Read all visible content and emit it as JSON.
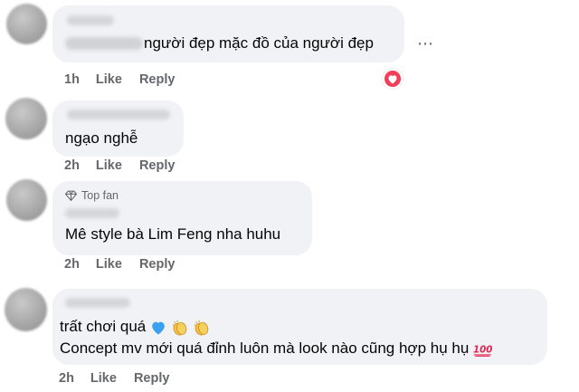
{
  "comments": [
    {
      "badge": "",
      "text": "người đẹp mặc đồ của người đẹp",
      "time": "1h",
      "like_label": "Like",
      "reply_label": "Reply",
      "reaction": "heart-icon"
    },
    {
      "badge": "",
      "text": "ngạo nghễ",
      "time": "2h",
      "like_label": "Like",
      "reply_label": "Reply"
    },
    {
      "badge": "Top fan",
      "text": "Mê style bà Lim Feng nha huhu",
      "time": "2h",
      "like_label": "Like",
      "reply_label": "Reply"
    },
    {
      "badge": "",
      "text_line1": "trất chơi quá",
      "text_line2": "Concept mv mới quá đỉnh luôn mà look nào cũng hợp hụ hụ",
      "time": "2h",
      "like_label": "Like",
      "reply_label": "Reply"
    }
  ],
  "more_options": "⋯",
  "colors": {
    "bubble": "#f0f2f5",
    "text": "#050505",
    "meta": "#65676b",
    "heart": "#f33e58",
    "blue_heart": "#3aa0f0",
    "clap": "#f5c244",
    "hundred": "#e5254f"
  }
}
